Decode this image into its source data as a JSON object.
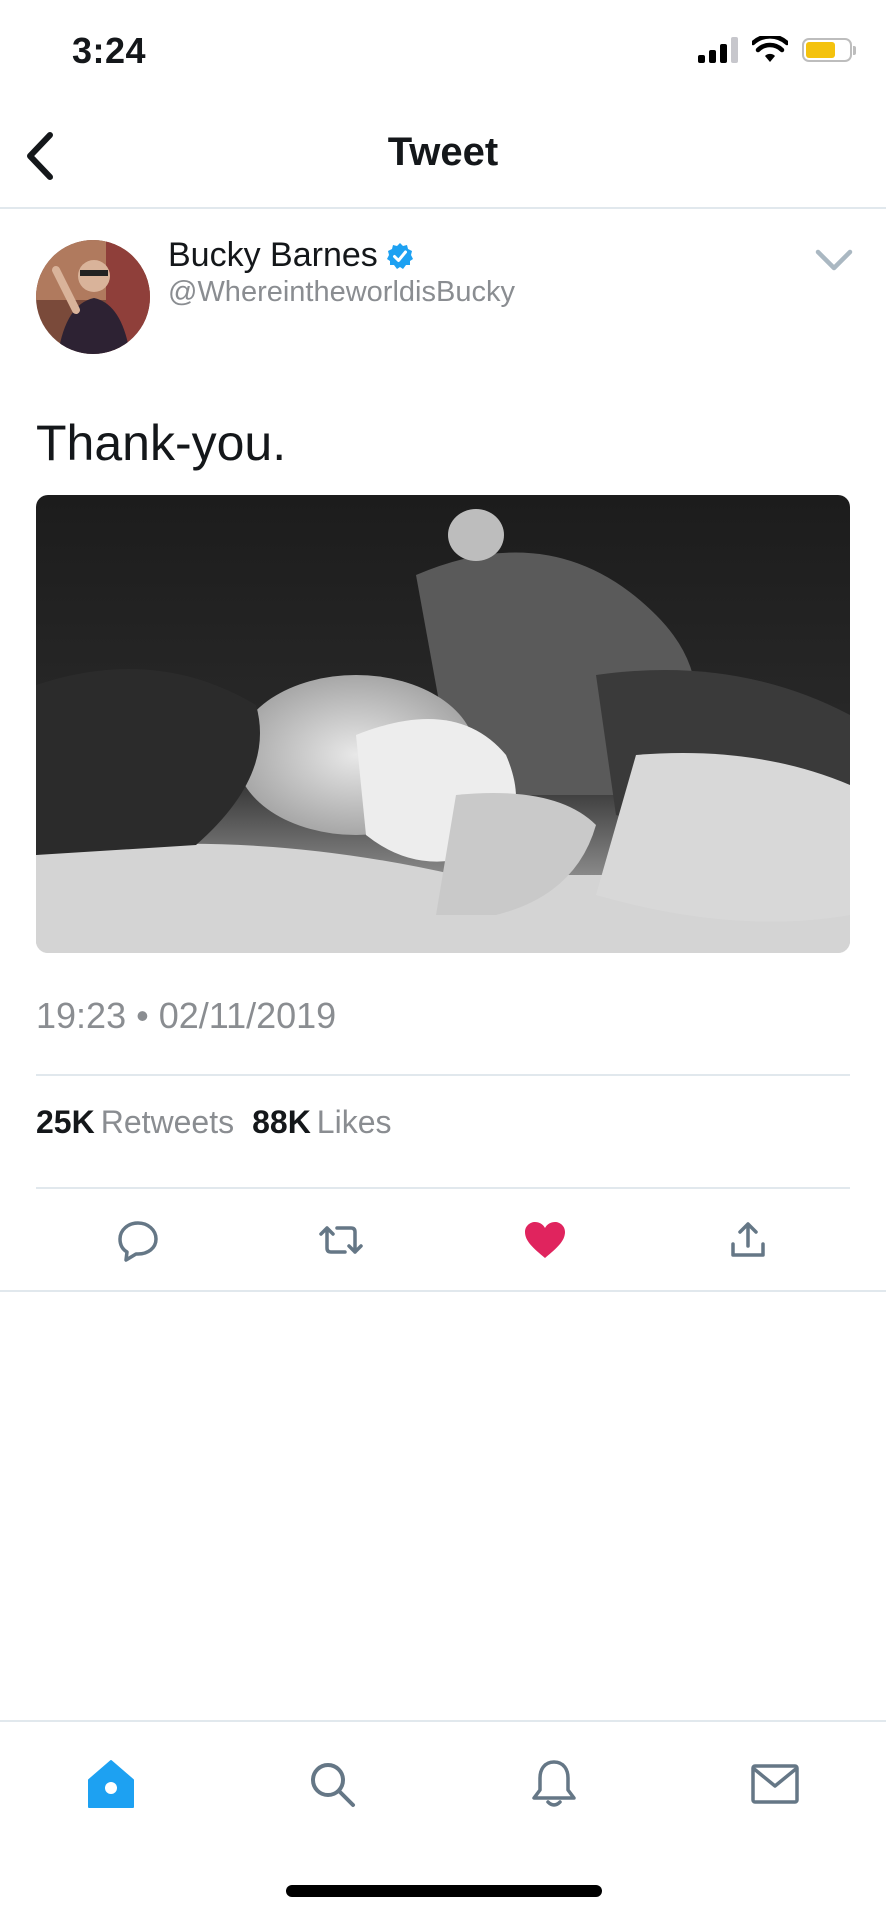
{
  "status_bar": {
    "time": "3:24",
    "icons": [
      "cellular-signal-icon",
      "wifi-icon",
      "battery-icon"
    ],
    "battery_color": "#f4c20d"
  },
  "nav": {
    "back_icon": "chevron-left-icon",
    "title": "Tweet"
  },
  "tweet": {
    "author_name": "Bucky Barnes",
    "verified": true,
    "verified_color": "#1da1f2",
    "handle": "@WhereintheworldisBucky",
    "text": "Thank-you.",
    "media": "black-and-white photo of two people cuddling under a fuzzy blanket",
    "timestamp": "19:23 • 02/11/2019",
    "retweets_count": "25K",
    "retweets_label": "Retweets",
    "likes_count": "88K",
    "likes_label": "Likes",
    "liked": true,
    "like_color": "#e0245e"
  },
  "actions": [
    "reply-icon",
    "retweet-icon",
    "like-icon",
    "share-icon"
  ],
  "tabbar": {
    "items": [
      "home-icon",
      "search-icon",
      "notifications-icon",
      "messages-icon"
    ],
    "active": "home-icon",
    "active_color": "#1da1f2"
  }
}
